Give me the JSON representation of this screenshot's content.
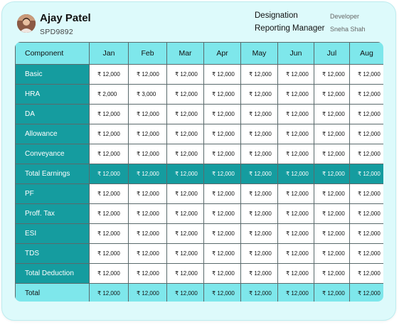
{
  "employee": {
    "name": "Ajay Patel",
    "id": "SPD9892"
  },
  "meta": {
    "designation_label": "Designation",
    "designation_value": "Developer",
    "manager_label": "Reporting Manager",
    "manager_value": "Sneha Shah"
  },
  "table": {
    "header": [
      "Component",
      "Jan",
      "Feb",
      "Mar",
      "Apr",
      "May",
      "Jun",
      "Jul",
      "Aug"
    ],
    "rows": [
      {
        "label": "Basic",
        "kind": "item",
        "values": [
          "₹ 12,000",
          "₹ 12,000",
          "₹ 12,000",
          "₹ 12,000",
          "₹ 12,000",
          "₹ 12,000",
          "₹ 12,000",
          "₹ 12,000"
        ]
      },
      {
        "label": "HRA",
        "kind": "item",
        "values": [
          "₹ 2,000",
          "₹ 3,000",
          "₹ 12,000",
          "₹ 12,000",
          "₹ 12,000",
          "₹ 12,000",
          "₹ 12,000",
          "₹ 12,000"
        ]
      },
      {
        "label": "DA",
        "kind": "item",
        "values": [
          "₹ 12,000",
          "₹ 12,000",
          "₹ 12,000",
          "₹ 12,000",
          "₹ 12,000",
          "₹ 12,000",
          "₹ 12,000",
          "₹ 12,000"
        ]
      },
      {
        "label": "Allowance",
        "kind": "item",
        "values": [
          "₹ 12,000",
          "₹ 12,000",
          "₹ 12,000",
          "₹ 12,000",
          "₹ 12,000",
          "₹ 12,000",
          "₹ 12,000",
          "₹ 12,000"
        ]
      },
      {
        "label": "Conveyance",
        "kind": "item",
        "values": [
          "₹ 12,000",
          "₹ 12,000",
          "₹ 12,000",
          "₹ 12,000",
          "₹ 12,000",
          "₹ 12,000",
          "₹ 12,000",
          "₹ 12,000"
        ]
      },
      {
        "label": "Total Earnings",
        "kind": "earn",
        "values": [
          "₹ 12,000",
          "₹ 12,000",
          "₹ 12,000",
          "₹ 12,000",
          "₹ 12,000",
          "₹ 12,000",
          "₹ 12,000",
          "₹ 12,000"
        ]
      },
      {
        "label": "PF",
        "kind": "item",
        "values": [
          "₹ 12,000",
          "₹ 12,000",
          "₹ 12,000",
          "₹ 12,000",
          "₹ 12,000",
          "₹ 12,000",
          "₹ 12,000",
          "₹ 12,000"
        ]
      },
      {
        "label": "Proff. Tax",
        "kind": "item",
        "values": [
          "₹ 12,000",
          "₹ 12,000",
          "₹ 12,000",
          "₹ 12,000",
          "₹ 12,000",
          "₹ 12,000",
          "₹ 12,000",
          "₹ 12,000"
        ]
      },
      {
        "label": "ESI",
        "kind": "item",
        "values": [
          "₹ 12,000",
          "₹ 12,000",
          "₹ 12,000",
          "₹ 12,000",
          "₹ 12,000",
          "₹ 12,000",
          "₹ 12,000",
          "₹ 12,000"
        ]
      },
      {
        "label": "TDS",
        "kind": "item",
        "values": [
          "₹ 12,000",
          "₹ 12,000",
          "₹ 12,000",
          "₹ 12,000",
          "₹ 12,000",
          "₹ 12,000",
          "₹ 12,000",
          "₹ 12,000"
        ]
      },
      {
        "label": "Total Deduction",
        "kind": "item",
        "values": [
          "₹ 12,000",
          "₹ 12,000",
          "₹ 12,000",
          "₹ 12,000",
          "₹ 12,000",
          "₹ 12,000",
          "₹ 12,000",
          "₹ 12,000"
        ]
      },
      {
        "label": "Total",
        "kind": "total",
        "values": [
          "₹ 12,000",
          "₹ 12,000",
          "₹ 12,000",
          "₹ 12,000",
          "₹ 12,000",
          "₹ 12,000",
          "₹ 12,000",
          "₹ 12,000"
        ]
      }
    ]
  },
  "colors": {
    "accent_dark": "#159c9f",
    "accent_light": "#7ee7eb",
    "card_bg": "#ddfafb"
  }
}
